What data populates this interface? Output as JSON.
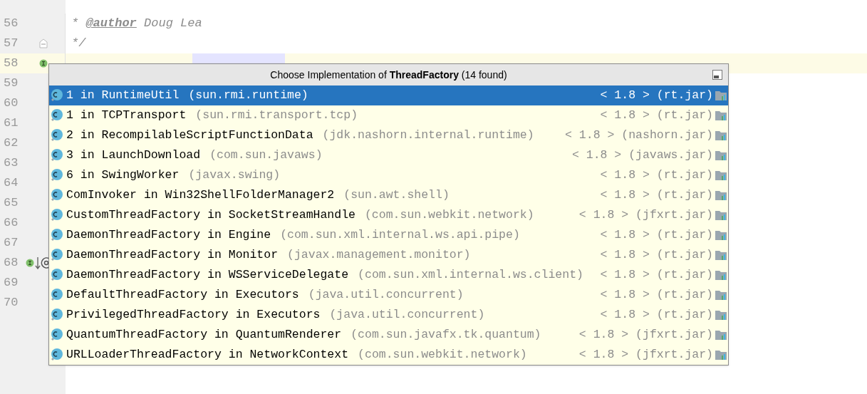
{
  "editor": {
    "lines": [
      {
        "number": "56",
        "tokens": [
          {
            "kind": "comment",
            "text": "* "
          },
          {
            "kind": "tag",
            "text": "@author"
          },
          {
            "kind": "comment",
            "text": " Doug Lea"
          }
        ]
      },
      {
        "number": "57",
        "gutter_marker": {
          "kind": "fold"
        },
        "tokens": [
          {
            "kind": "comment",
            "text": "*/"
          }
        ]
      },
      {
        "number": "58",
        "gutter_marker": {
          "kind": "implemented"
        },
        "current": true
      },
      {
        "number": "59"
      },
      {
        "number": "60"
      },
      {
        "number": "61"
      },
      {
        "number": "62"
      },
      {
        "number": "63"
      },
      {
        "number": "64"
      },
      {
        "number": "65"
      },
      {
        "number": "66"
      },
      {
        "number": "67"
      },
      {
        "number": "68",
        "gutter_marker": {
          "kind": "implemented_down"
        }
      },
      {
        "number": "69"
      },
      {
        "number": "70"
      }
    ]
  },
  "popup": {
    "title": "Choose Implementation of **ThreadFactory** (14 found)",
    "items": [
      {
        "name": "1 in RuntimeUtil",
        "location": "(sun.rmi.runtime)",
        "library": "< 1.8 > (rt.jar)",
        "selected": true
      },
      {
        "name": "1 in TCPTransport",
        "location": "(sun.rmi.transport.tcp)",
        "library": "< 1.8 > (rt.jar)",
        "selected": false
      },
      {
        "name": "2 in RecompilableScriptFunctionData",
        "location": "(jdk.nashorn.internal.runtime)",
        "library": "< 1.8 > (nashorn.jar)",
        "selected": false
      },
      {
        "name": "3 in LaunchDownload",
        "location": "(com.sun.javaws)",
        "library": "< 1.8 > (javaws.jar)",
        "selected": false
      },
      {
        "name": "6 in SwingWorker",
        "location": "(javax.swing)",
        "library": "< 1.8 > (rt.jar)",
        "selected": false
      },
      {
        "name": "ComInvoker in Win32ShellFolderManager2",
        "location": "(sun.awt.shell)",
        "library": "< 1.8 > (rt.jar)",
        "selected": false
      },
      {
        "name": "CustomThreadFactory in SocketStreamHandle",
        "location": "(com.sun.webkit.network)",
        "library": "< 1.8 > (jfxrt.jar)",
        "selected": false
      },
      {
        "name": "DaemonThreadFactory in Engine",
        "location": "(com.sun.xml.internal.ws.api.pipe)",
        "library": "< 1.8 > (rt.jar)",
        "selected": false
      },
      {
        "name": "DaemonThreadFactory in Monitor",
        "location": "(javax.management.monitor)",
        "library": "< 1.8 > (rt.jar)",
        "selected": false
      },
      {
        "name": "DaemonThreadFactory in WSServiceDelegate",
        "location": "(com.sun.xml.internal.ws.client)",
        "library": "< 1.8 > (rt.jar)",
        "selected": false
      },
      {
        "name": "DefaultThreadFactory in Executors",
        "location": "(java.util.concurrent)",
        "library": "< 1.8 > (rt.jar)",
        "selected": false
      },
      {
        "name": "PrivilegedThreadFactory in Executors",
        "location": "(java.util.concurrent)",
        "library": "< 1.8 > (rt.jar)",
        "selected": false
      },
      {
        "name": "QuantumThreadFactory in QuantumRenderer",
        "location": "(com.sun.javafx.tk.quantum)",
        "library": "< 1.8 > (jfxrt.jar)",
        "selected": false
      },
      {
        "name": "URLLoaderThreadFactory in NetworkContext",
        "location": "(com.sun.webkit.network)",
        "library": "< 1.8 > (jfxrt.jar)",
        "selected": false
      }
    ]
  }
}
